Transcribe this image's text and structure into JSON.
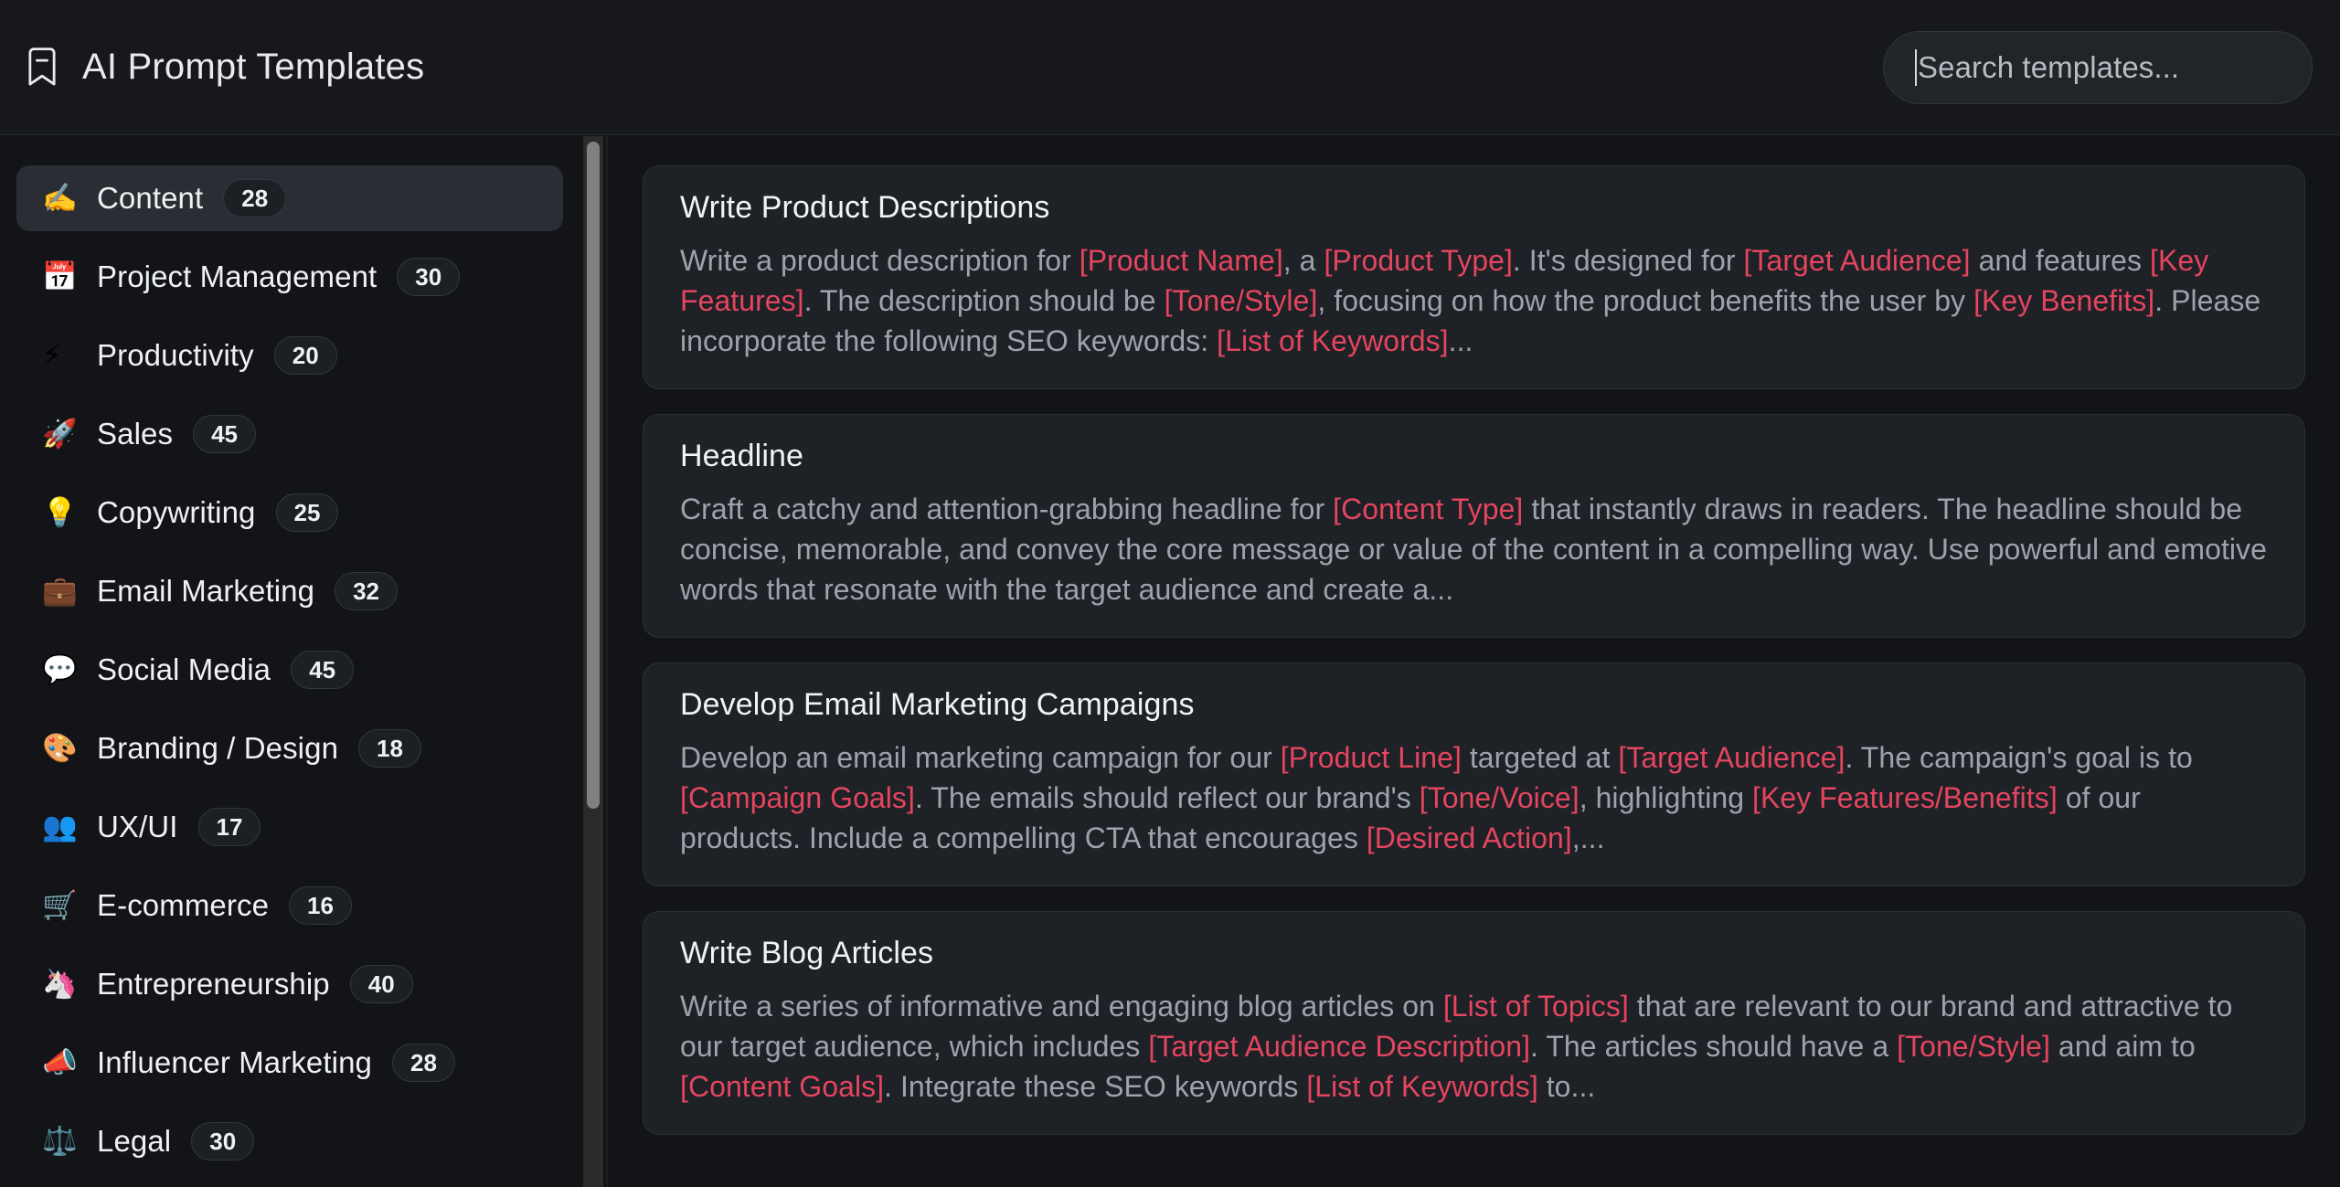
{
  "header": {
    "title": "AI Prompt Templates",
    "bookmark_icon": "bookmark-minus-icon",
    "search": {
      "placeholder": "Search templates...",
      "value": "",
      "focused": true
    }
  },
  "colors": {
    "page_background": "#121417",
    "header_background": "#16181c",
    "card_background": "#1e2126",
    "active_item_background": "#2a2d33",
    "body_text": "#9ea3ab",
    "placeholder_token": "#e4455f",
    "scrollbar_thumb": "#808080"
  },
  "sidebar": {
    "active_index": 0,
    "items": [
      {
        "emoji": "✍️",
        "icon_name": "writing-hand-icon",
        "label": "Content",
        "count": "28"
      },
      {
        "emoji": "📅",
        "icon_name": "calendar-icon",
        "label": "Project Management",
        "count": "30"
      },
      {
        "emoji": "⚡",
        "icon_name": "lightning-bolt-icon",
        "label": "Productivity",
        "count": "20"
      },
      {
        "emoji": "🚀",
        "icon_name": "rocket-icon",
        "label": "Sales",
        "count": "45"
      },
      {
        "emoji": "💡",
        "icon_name": "lightbulb-icon",
        "label": "Copywriting",
        "count": "25"
      },
      {
        "emoji": "💼",
        "icon_name": "briefcase-icon",
        "label": "Email Marketing",
        "count": "32"
      },
      {
        "emoji": "💬",
        "icon_name": "speech-balloon-icon",
        "label": "Social Media",
        "count": "45"
      },
      {
        "emoji": "🎨",
        "icon_name": "artist-palette-icon",
        "label": "Branding / Design",
        "count": "18"
      },
      {
        "emoji": "👥",
        "icon_name": "busts-in-silhouette-icon",
        "label": "UX/UI",
        "count": "17"
      },
      {
        "emoji": "🛒",
        "icon_name": "shopping-cart-icon",
        "label": "E-commerce",
        "count": "16"
      },
      {
        "emoji": "🦄",
        "icon_name": "unicorn-icon",
        "label": "Entrepreneurship",
        "count": "40"
      },
      {
        "emoji": "📣",
        "icon_name": "megaphone-icon",
        "label": "Influencer Marketing",
        "count": "28"
      },
      {
        "emoji": "⚖️",
        "icon_name": "balance-scale-icon",
        "label": "Legal",
        "count": "30"
      }
    ]
  },
  "main": {
    "cards": [
      {
        "title": "Write Product Descriptions",
        "body": [
          {
            "t": "Write a product description for "
          },
          {
            "t": "[Product Name]",
            "ph": true
          },
          {
            "t": ", a "
          },
          {
            "t": "[Product Type]",
            "ph": true
          },
          {
            "t": ". It's designed for "
          },
          {
            "t": "[Target Audience]",
            "ph": true
          },
          {
            "t": " and features "
          },
          {
            "t": "[Key Features]",
            "ph": true
          },
          {
            "t": ". The description should be "
          },
          {
            "t": "[Tone/Style]",
            "ph": true
          },
          {
            "t": ", focusing on how the product benefits the user by "
          },
          {
            "t": "[Key Benefits]",
            "ph": true
          },
          {
            "t": ". Please incorporate the following SEO keywords: "
          },
          {
            "t": "[List of Keywords]",
            "ph": true
          },
          {
            "t": "..."
          }
        ]
      },
      {
        "title": "Headline",
        "body": [
          {
            "t": "Craft a catchy and attention-grabbing headline for "
          },
          {
            "t": "[Content Type]",
            "ph": true
          },
          {
            "t": " that instantly draws in readers. The headline should be concise, memorable, and convey the core message or value of the content in a compelling way. Use powerful and emotive words that resonate with the target audience and create a..."
          }
        ]
      },
      {
        "title": "Develop Email Marketing Campaigns",
        "body": [
          {
            "t": "Develop an email marketing campaign for our "
          },
          {
            "t": "[Product Line]",
            "ph": true
          },
          {
            "t": " targeted at "
          },
          {
            "t": "[Target Audience]",
            "ph": true
          },
          {
            "t": ". The campaign's goal is to "
          },
          {
            "t": "[Campaign Goals]",
            "ph": true
          },
          {
            "t": ". The emails should reflect our brand's "
          },
          {
            "t": "[Tone/Voice]",
            "ph": true
          },
          {
            "t": ", highlighting "
          },
          {
            "t": "[Key Features/Benefits]",
            "ph": true
          },
          {
            "t": " of our products. Include a compelling CTA that encourages "
          },
          {
            "t": "[Desired Action]",
            "ph": true
          },
          {
            "t": ",..."
          }
        ]
      },
      {
        "title": "Write Blog Articles",
        "body": [
          {
            "t": "Write a series of informative and engaging blog articles on "
          },
          {
            "t": "[List of Topics]",
            "ph": true
          },
          {
            "t": " that are relevant to our brand and attractive to our target audience, which includes "
          },
          {
            "t": "[Target Audience Description]",
            "ph": true
          },
          {
            "t": ". The articles should have a "
          },
          {
            "t": "[Tone/Style]",
            "ph": true
          },
          {
            "t": " and aim to "
          },
          {
            "t": "[Content Goals]",
            "ph": true
          },
          {
            "t": ". Integrate these SEO keywords "
          },
          {
            "t": "[List of Keywords]",
            "ph": true
          },
          {
            "t": " to..."
          }
        ]
      }
    ]
  }
}
